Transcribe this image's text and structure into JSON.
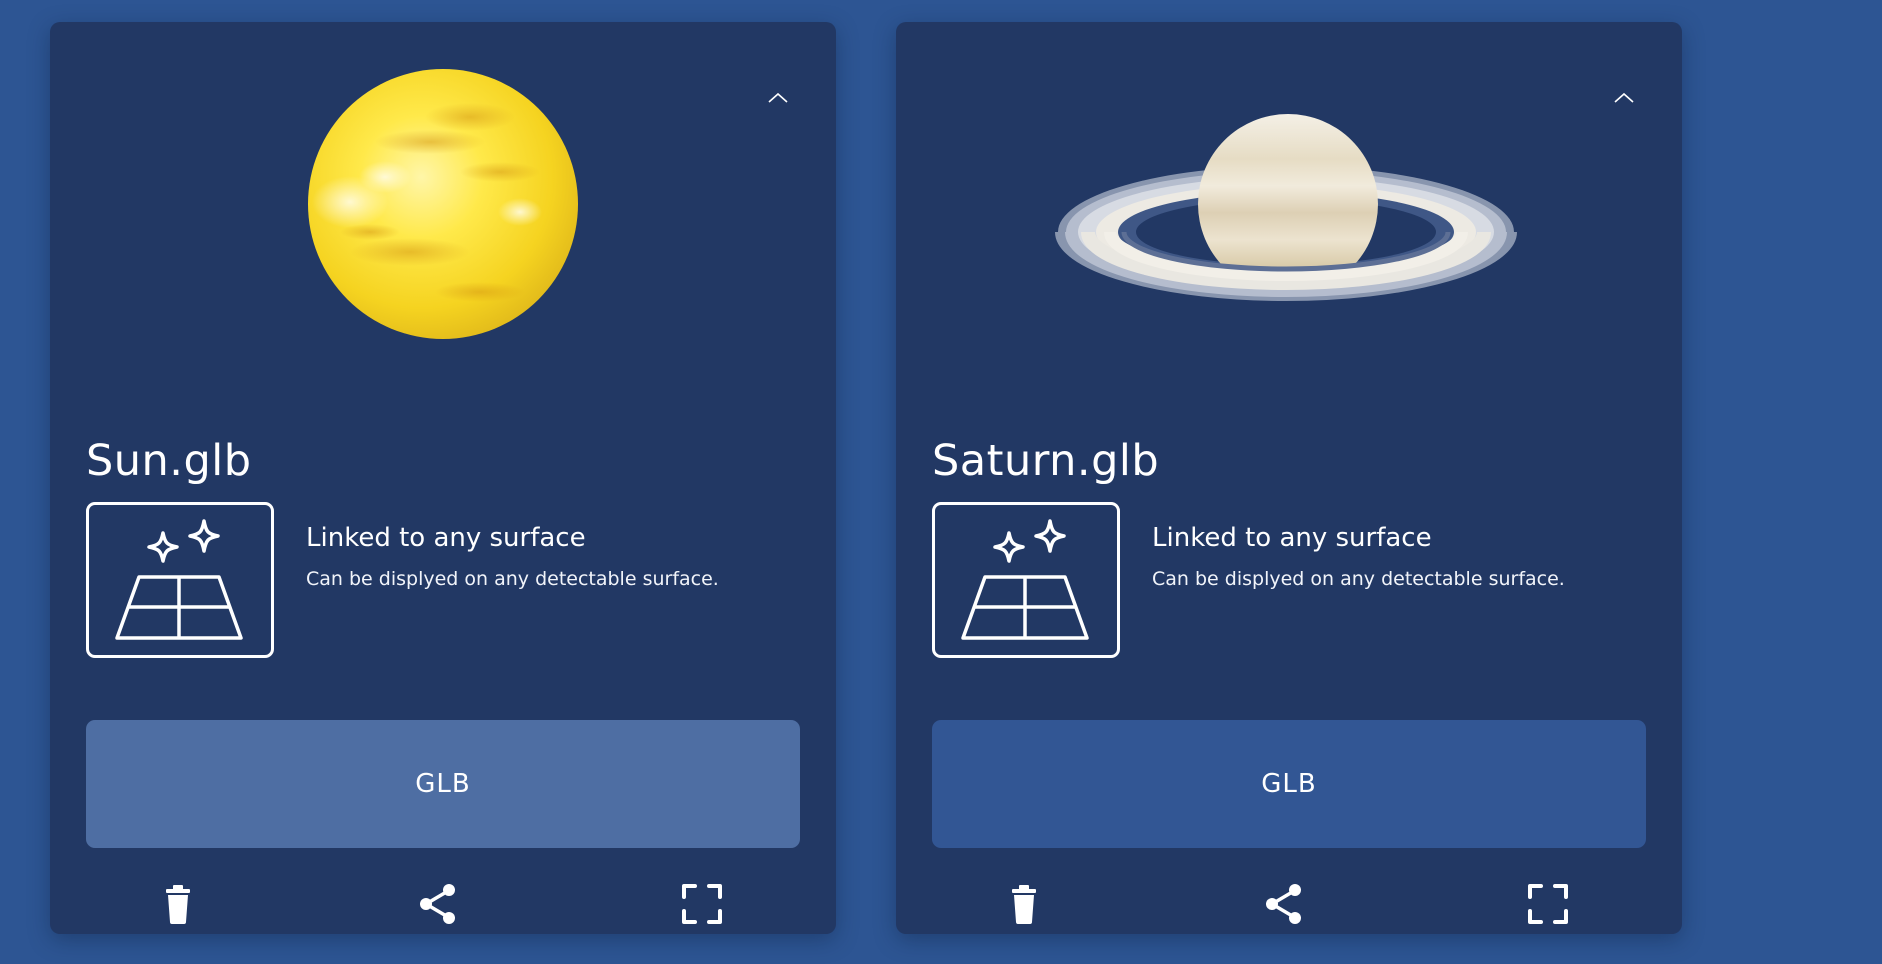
{
  "cards": [
    {
      "file_name": "Sun.glb",
      "preview": "sun",
      "feature": {
        "icon": "surface-icon",
        "title": "Linked to any surface",
        "description": "Can be displyed on any detectable surface."
      },
      "format_label": "GLB",
      "actions": [
        "trash-icon",
        "share-icon",
        "fullscreen-icon"
      ]
    },
    {
      "file_name": "Saturn.glb",
      "preview": "saturn",
      "feature": {
        "icon": "surface-icon",
        "title": "Linked to any surface",
        "description": "Can be displyed on any detectable surface."
      },
      "format_label": "GLB",
      "actions": [
        "trash-icon",
        "share-icon",
        "fullscreen-icon"
      ]
    }
  ],
  "colors": {
    "page_background": "#2d5593",
    "card_background": "#223864",
    "sun_format_button": "#4e6ea3",
    "saturn_format_button": "#325694",
    "text": "#ffffff"
  }
}
